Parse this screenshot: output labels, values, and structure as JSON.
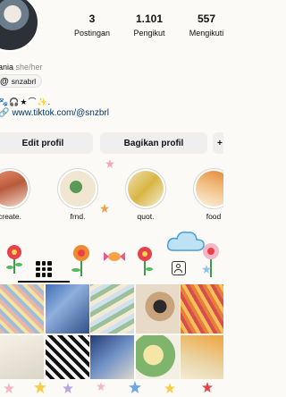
{
  "profile": {
    "name_fragment": "ania",
    "pronouns": "she/her",
    "threads_handle": "snzabrl",
    "bio_emojis": "🐾🎧★⌒✨.",
    "link": "www.tiktok.com/@snzbrl"
  },
  "stats": [
    {
      "value": "3",
      "label": "Postingan"
    },
    {
      "value": "1.101",
      "label": "Pengikut"
    },
    {
      "value": "557",
      "label": "Mengikuti"
    }
  ],
  "buttons": {
    "edit": "Edit profil",
    "share": "Bagikan profil",
    "add": "+"
  },
  "highlights": [
    {
      "label": "create."
    },
    {
      "label": "frnd."
    },
    {
      "label": "quot."
    },
    {
      "label": "food"
    }
  ],
  "icons": {
    "threads": "threads-icon",
    "link": "link-icon",
    "grid": "grid-icon",
    "tagged": "tagged-icon"
  },
  "colors": {
    "link": "#00376b",
    "button_bg": "#efefef",
    "page_bg": "#fbfaf6"
  }
}
